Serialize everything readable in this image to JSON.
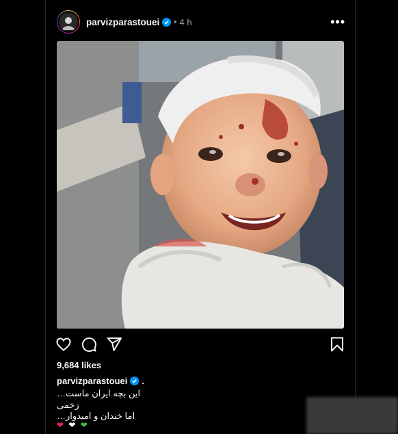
{
  "header": {
    "username": "parvizparastouei",
    "dot": "•",
    "time": "4 h",
    "more": "•••"
  },
  "post": {
    "likes": "9,684 likes",
    "caption_user": "parvizparastouei",
    "caption_after": ".",
    "caption_lines": [
      "این بچه ایران ماست…",
      "زخمی",
      "اما خندان و امیدوار…"
    ],
    "hearts": [
      "❤",
      "❤",
      "❤"
    ]
  },
  "colors": {
    "verified": "#0095f6",
    "heart_red": "#e0245e",
    "heart_white": "#ffffff",
    "heart_green": "#3cc33c"
  },
  "icons": [
    "heart-icon",
    "comment-icon",
    "share-icon",
    "bookmark-icon",
    "verified-badge-icon",
    "more-options-icon"
  ]
}
